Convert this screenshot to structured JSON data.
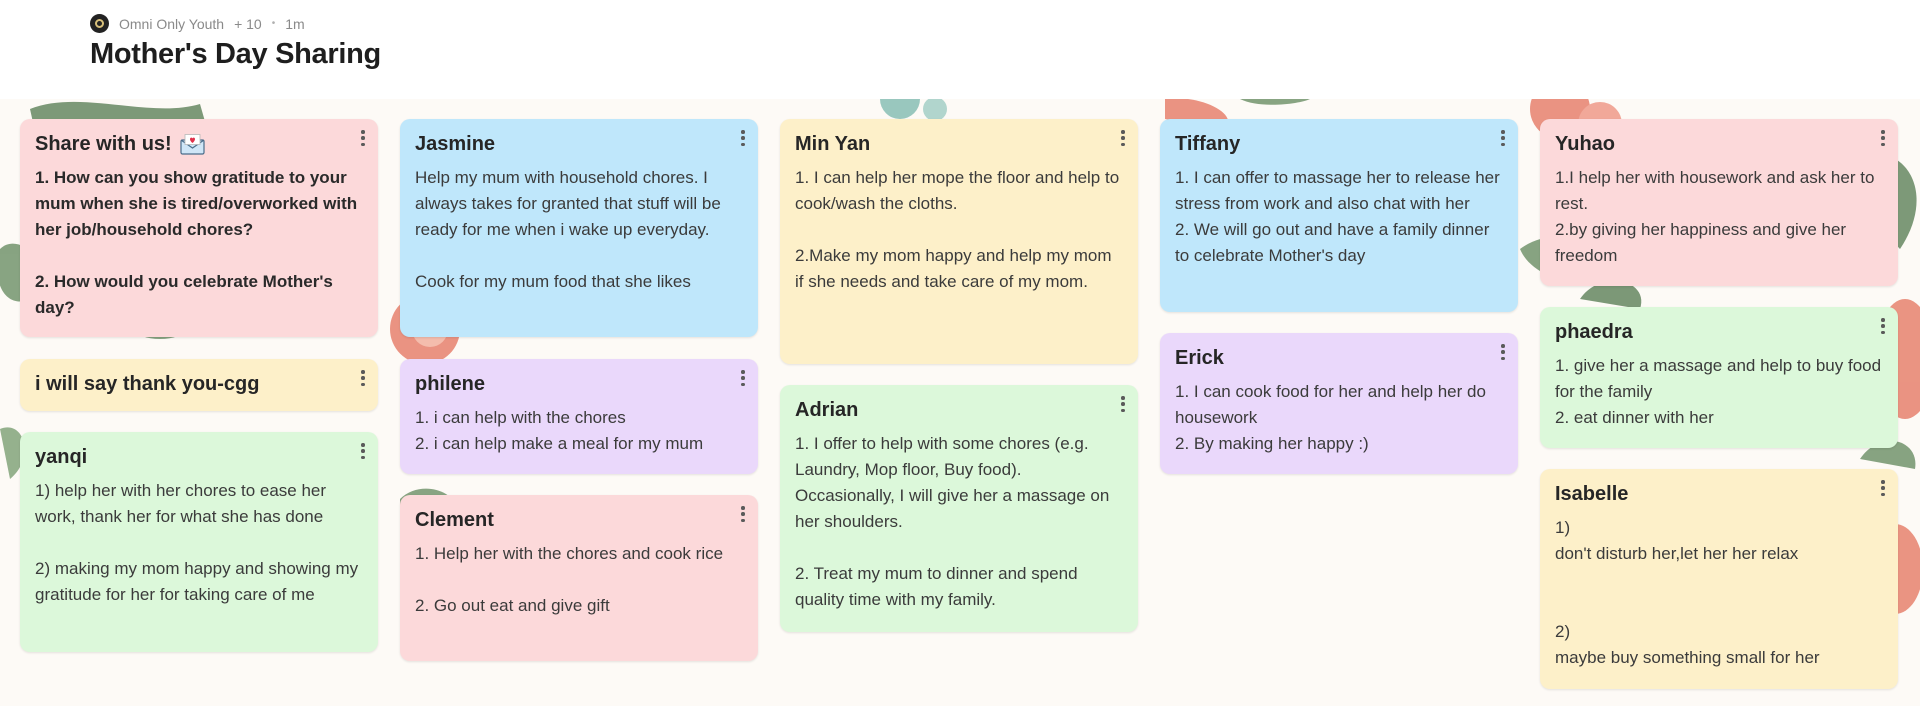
{
  "meta": {
    "author": "Omni Only Youth",
    "plus_label": "+ 10",
    "sep": "•",
    "time": "1m"
  },
  "page_title": "Mother's Day Sharing",
  "cards": [
    {
      "title": "Share with us!",
      "icon": "envelope-heart-icon",
      "body": "1. How can you show gratitude to your mum when she is tired/overworked with her job/household chores?\n\n2. How would you celebrate Mother's day?"
    },
    {
      "title": "i will say thank you-cgg",
      "body": ""
    },
    {
      "title": "yanqi",
      "body": "1) help her with her chores to ease her work, thank her for what she has done\n\n2) making my mom happy and showing my gratitude for her for taking care of me"
    },
    {
      "title": "Jasmine",
      "body": "Help my mum with household chores. I always takes for granted that stuff will be ready for me when i wake up everyday.\n\nCook for my mum food that she likes"
    },
    {
      "title": "philene",
      "body": "1. i can help with the chores\n2. i can help make a meal for my mum"
    },
    {
      "title": "Clement",
      "body": "1. Help her with the chores and cook rice\n\n2. Go out eat and give gift"
    },
    {
      "title": "Min Yan",
      "body": "1. I can help her mope the floor and help to cook/wash the cloths.\n\n2.Make my mom happy and help my mom if she needs and take care of my mom."
    },
    {
      "title": "Adrian",
      "body": "1. I offer to help with some chores (e.g. Laundry, Mop floor, Buy food). Occasionally, I will give her a massage on her shoulders.\n\n2. Treat my mum to dinner and spend quality time with my family."
    },
    {
      "title": "Tiffany",
      "body": "1. I can offer to massage her to release her stress from work and also chat with her\n2. We will go out and have a family dinner to celebrate Mother's day"
    },
    {
      "title": "Erick",
      "body": "1. I can cook food for her and help her do housework\n2. By making her happy :)"
    },
    {
      "title": "Yuhao",
      "body": "1.I help her with housework and ask her to rest.\n2.by giving her happiness and give her freedom"
    },
    {
      "title": "phaedra",
      "body": "1. give her a massage and help to buy food for the family\n2. eat dinner with her"
    },
    {
      "title": "Isabelle",
      "body": "1)\ndon't disturb her,let her her relax\n\n\n2)\nmaybe buy something small for her"
    }
  ]
}
